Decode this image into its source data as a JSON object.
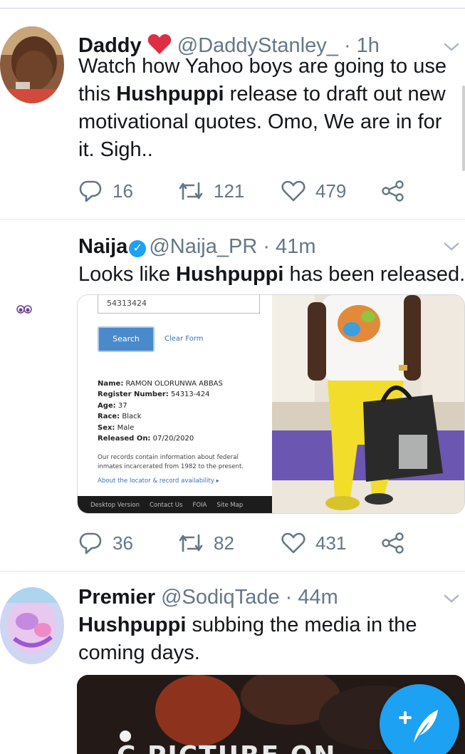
{
  "tweets": [
    {
      "name": "Daddy",
      "name_emoji": "❤️",
      "handle": "@DaddyStanley_",
      "time": "· 1h",
      "text_before": "Watch how Yahoo boys are going to use this ",
      "text_bold": "Hushpuppi",
      "text_after": " release to draft out new motivational quotes. Omo, We are in for it. Sigh..",
      "replies": "16",
      "retweets": "121",
      "likes": "479"
    },
    {
      "name": "Naija",
      "handle": "@Naija_PR",
      "time": "· 41m",
      "text_before": "Looks like ",
      "text_bold": "Hushpuppi",
      "text_after": " has been released.",
      "replies": "36",
      "retweets": "82",
      "likes": "431",
      "media_doc": {
        "register_input": "54313424",
        "search_button": "Search",
        "clear_form": "Clear Form",
        "name_label": "Name:",
        "name_value": "RAMON OLORUNWA ABBAS",
        "register_label": "Register Number:",
        "register_value": "54313-424",
        "age_label": "Age:",
        "age_value": "37",
        "race_label": "Race:",
        "race_value": "Black",
        "sex_label": "Sex:",
        "sex_value": "Male",
        "released_label": "Released On:",
        "released_value": "07/20/2020",
        "note": "Our records contain information about federal inmates incarcerated from 1982 to the present.",
        "about_link": "About the locator & record availability ▸",
        "footer": [
          "Desktop Version",
          "Contact Us",
          "FOIA",
          "Site Map"
        ]
      }
    },
    {
      "name": "Premier",
      "handle": "@SodiqTade",
      "time": "· 44m",
      "text_before": "",
      "text_bold": "Hushpuppi",
      "text_after": " subbing the media in the coming days.",
      "video_caption": "C PICTURE ON"
    }
  ],
  "colors": {
    "accent": "#1da1f2",
    "like": "#e0245e",
    "secondary_text": "#657786"
  },
  "icons": [
    "reply-icon",
    "retweet-icon",
    "like-icon",
    "share-icon",
    "chevron-down-icon",
    "verified-icon",
    "compose-tweet-icon"
  ]
}
